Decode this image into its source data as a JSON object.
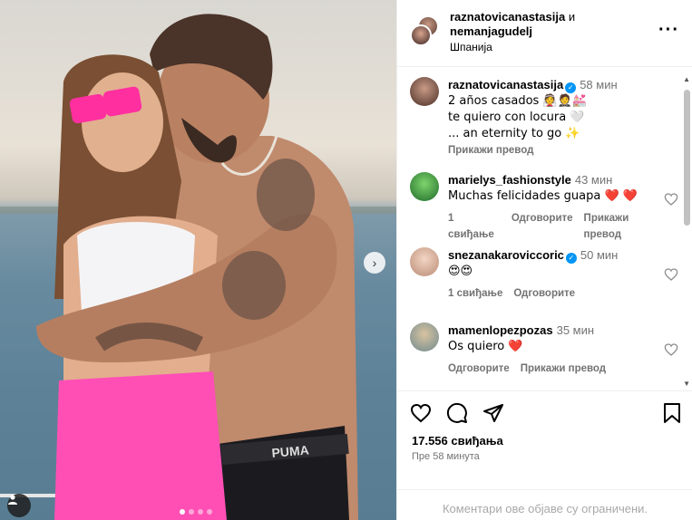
{
  "post": {
    "carousel_dots": 4,
    "carousel_active": 0
  },
  "header": {
    "user1": "raznatovicanastasija",
    "and_word": "и",
    "user2": "nemanjagudelj",
    "location": "Шпанија"
  },
  "caption": {
    "username": "raznatovicanastasija",
    "time": "58 мин",
    "line1": "2 años casados 👰🤵💒",
    "line2": "te quiero con locura 🤍",
    "line3": "... an eternity to go ✨",
    "translate": "Прикажи превод"
  },
  "comments": [
    {
      "username": "marielys_fashionstyle",
      "time": "43 мин",
      "text": "Muchas felicidades guapa ❤️ ❤️",
      "likes": "1 свиђање",
      "reply": "Одговорите",
      "translate": "Прикажи превод"
    },
    {
      "username": "snezanakaroviccoric",
      "time": "50 мин",
      "text": "😍😍",
      "likes": "1 свиђање",
      "reply": "Одговорите"
    },
    {
      "username": "mamenlopezpozas",
      "time": "35 мин",
      "text": "Os quiero ❤️",
      "reply": "Одговорите",
      "translate": "Прикажи превод"
    }
  ],
  "footer": {
    "likes": "17.556 свиђања",
    "time_ago": "Пре 58 минута",
    "restricted": "Коментари ове објаве су ограничени."
  },
  "colors": {
    "verified": "#0095f6",
    "muted": "#737373"
  }
}
